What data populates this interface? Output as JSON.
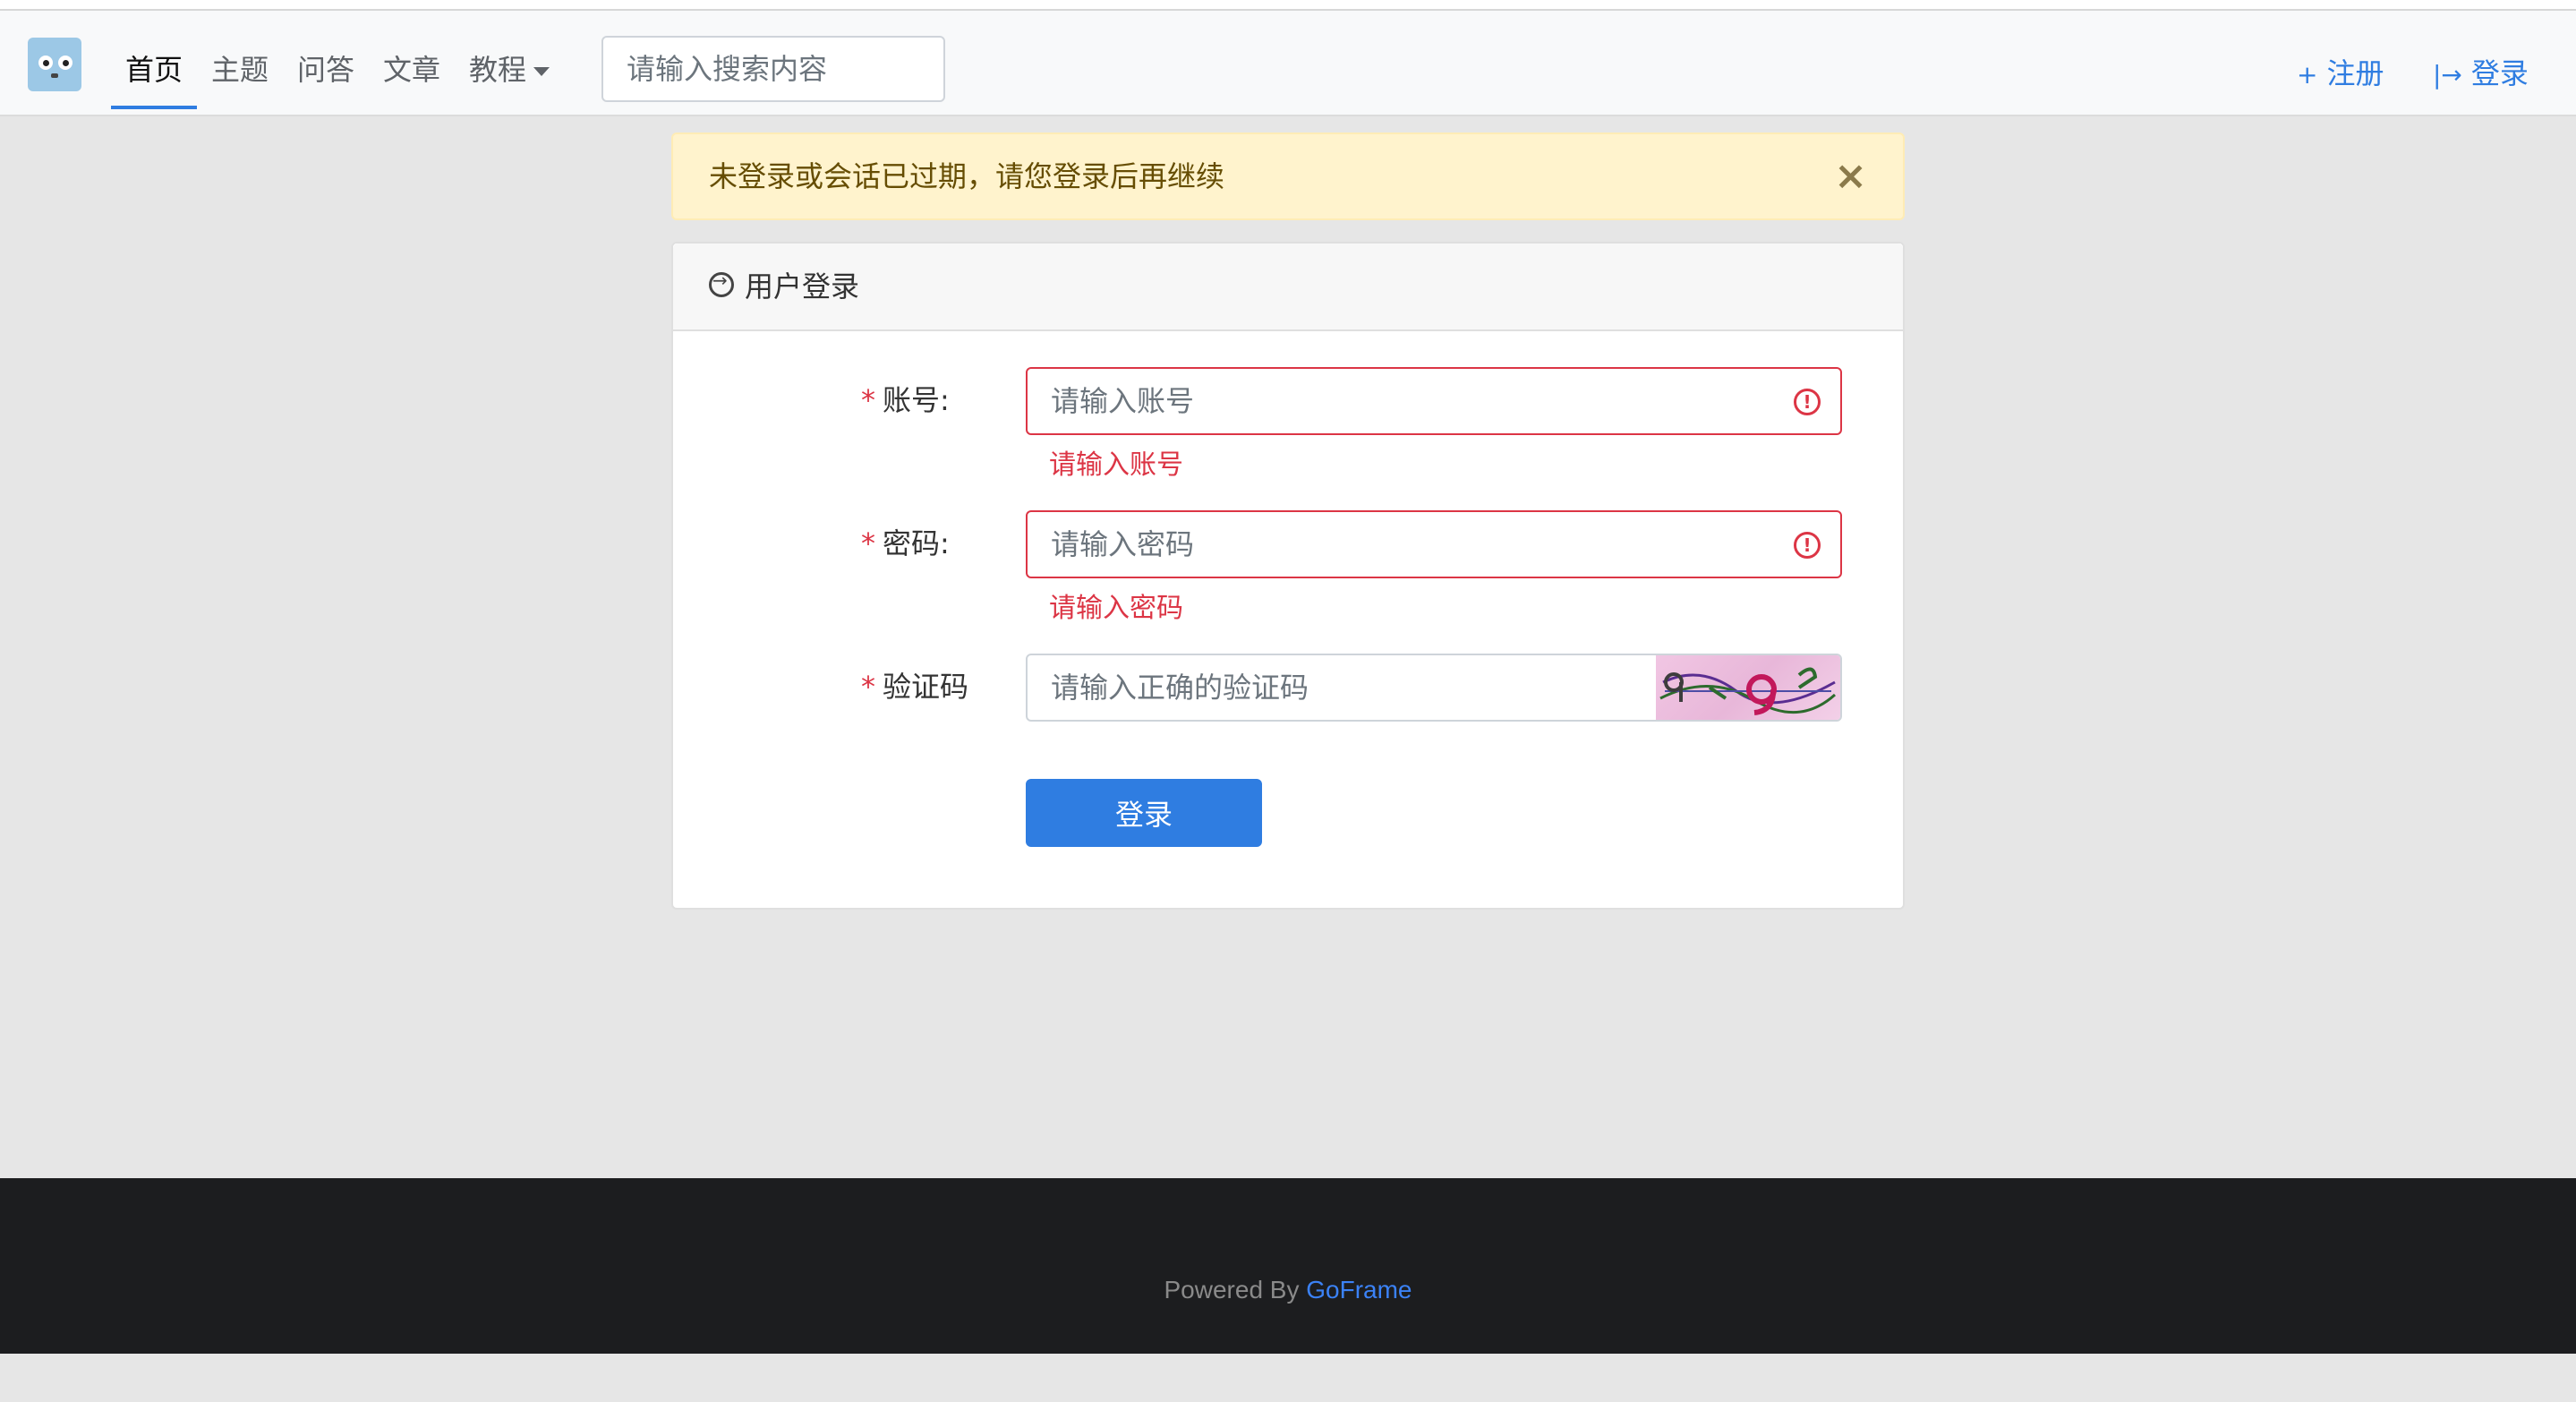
{
  "nav": {
    "items": [
      {
        "label": "首页"
      },
      {
        "label": "主题"
      },
      {
        "label": "问答"
      },
      {
        "label": "文章"
      },
      {
        "label": "教程"
      }
    ],
    "search_placeholder": "请输入搜索内容",
    "register_label": "注册",
    "login_label": "登录"
  },
  "alert": {
    "message": "未登录或会话已过期，请您登录后再继续",
    "close": "×"
  },
  "login": {
    "title": "用户登录",
    "fields": {
      "account": {
        "label": "账号:",
        "placeholder": "请输入账号",
        "error": "请输入账号"
      },
      "password": {
        "label": "密码:",
        "placeholder": "请输入密码",
        "error": "请输入密码"
      },
      "captcha": {
        "label": "验证码",
        "placeholder": "请输入正确的验证码"
      }
    },
    "required_mark": "*",
    "submit_label": "登录"
  },
  "footer": {
    "powered_by": "Powered By ",
    "link": "GoFrame"
  },
  "colors": {
    "primary": "#2f7de1",
    "danger": "#dc3545",
    "alert_bg": "#fff3cd",
    "footer_bg": "#1c1d1f"
  }
}
